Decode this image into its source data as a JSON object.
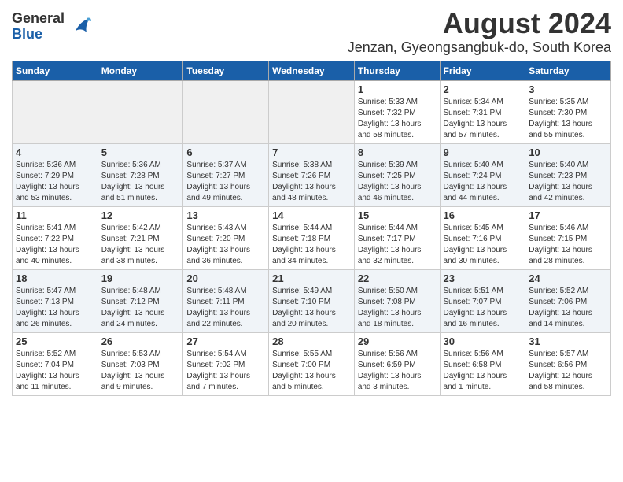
{
  "header": {
    "logo_general": "General",
    "logo_blue": "Blue",
    "title": "August 2024",
    "subtitle": "Jenzan, Gyeongsangbuk-do, South Korea"
  },
  "weekdays": [
    "Sunday",
    "Monday",
    "Tuesday",
    "Wednesday",
    "Thursday",
    "Friday",
    "Saturday"
  ],
  "weeks": [
    [
      {
        "day": "",
        "detail": ""
      },
      {
        "day": "",
        "detail": ""
      },
      {
        "day": "",
        "detail": ""
      },
      {
        "day": "",
        "detail": ""
      },
      {
        "day": "1",
        "detail": "Sunrise: 5:33 AM\nSunset: 7:32 PM\nDaylight: 13 hours\nand 58 minutes."
      },
      {
        "day": "2",
        "detail": "Sunrise: 5:34 AM\nSunset: 7:31 PM\nDaylight: 13 hours\nand 57 minutes."
      },
      {
        "day": "3",
        "detail": "Sunrise: 5:35 AM\nSunset: 7:30 PM\nDaylight: 13 hours\nand 55 minutes."
      }
    ],
    [
      {
        "day": "4",
        "detail": "Sunrise: 5:36 AM\nSunset: 7:29 PM\nDaylight: 13 hours\nand 53 minutes."
      },
      {
        "day": "5",
        "detail": "Sunrise: 5:36 AM\nSunset: 7:28 PM\nDaylight: 13 hours\nand 51 minutes."
      },
      {
        "day": "6",
        "detail": "Sunrise: 5:37 AM\nSunset: 7:27 PM\nDaylight: 13 hours\nand 49 minutes."
      },
      {
        "day": "7",
        "detail": "Sunrise: 5:38 AM\nSunset: 7:26 PM\nDaylight: 13 hours\nand 48 minutes."
      },
      {
        "day": "8",
        "detail": "Sunrise: 5:39 AM\nSunset: 7:25 PM\nDaylight: 13 hours\nand 46 minutes."
      },
      {
        "day": "9",
        "detail": "Sunrise: 5:40 AM\nSunset: 7:24 PM\nDaylight: 13 hours\nand 44 minutes."
      },
      {
        "day": "10",
        "detail": "Sunrise: 5:40 AM\nSunset: 7:23 PM\nDaylight: 13 hours\nand 42 minutes."
      }
    ],
    [
      {
        "day": "11",
        "detail": "Sunrise: 5:41 AM\nSunset: 7:22 PM\nDaylight: 13 hours\nand 40 minutes."
      },
      {
        "day": "12",
        "detail": "Sunrise: 5:42 AM\nSunset: 7:21 PM\nDaylight: 13 hours\nand 38 minutes."
      },
      {
        "day": "13",
        "detail": "Sunrise: 5:43 AM\nSunset: 7:20 PM\nDaylight: 13 hours\nand 36 minutes."
      },
      {
        "day": "14",
        "detail": "Sunrise: 5:44 AM\nSunset: 7:18 PM\nDaylight: 13 hours\nand 34 minutes."
      },
      {
        "day": "15",
        "detail": "Sunrise: 5:44 AM\nSunset: 7:17 PM\nDaylight: 13 hours\nand 32 minutes."
      },
      {
        "day": "16",
        "detail": "Sunrise: 5:45 AM\nSunset: 7:16 PM\nDaylight: 13 hours\nand 30 minutes."
      },
      {
        "day": "17",
        "detail": "Sunrise: 5:46 AM\nSunset: 7:15 PM\nDaylight: 13 hours\nand 28 minutes."
      }
    ],
    [
      {
        "day": "18",
        "detail": "Sunrise: 5:47 AM\nSunset: 7:13 PM\nDaylight: 13 hours\nand 26 minutes."
      },
      {
        "day": "19",
        "detail": "Sunrise: 5:48 AM\nSunset: 7:12 PM\nDaylight: 13 hours\nand 24 minutes."
      },
      {
        "day": "20",
        "detail": "Sunrise: 5:48 AM\nSunset: 7:11 PM\nDaylight: 13 hours\nand 22 minutes."
      },
      {
        "day": "21",
        "detail": "Sunrise: 5:49 AM\nSunset: 7:10 PM\nDaylight: 13 hours\nand 20 minutes."
      },
      {
        "day": "22",
        "detail": "Sunrise: 5:50 AM\nSunset: 7:08 PM\nDaylight: 13 hours\nand 18 minutes."
      },
      {
        "day": "23",
        "detail": "Sunrise: 5:51 AM\nSunset: 7:07 PM\nDaylight: 13 hours\nand 16 minutes."
      },
      {
        "day": "24",
        "detail": "Sunrise: 5:52 AM\nSunset: 7:06 PM\nDaylight: 13 hours\nand 14 minutes."
      }
    ],
    [
      {
        "day": "25",
        "detail": "Sunrise: 5:52 AM\nSunset: 7:04 PM\nDaylight: 13 hours\nand 11 minutes."
      },
      {
        "day": "26",
        "detail": "Sunrise: 5:53 AM\nSunset: 7:03 PM\nDaylight: 13 hours\nand 9 minutes."
      },
      {
        "day": "27",
        "detail": "Sunrise: 5:54 AM\nSunset: 7:02 PM\nDaylight: 13 hours\nand 7 minutes."
      },
      {
        "day": "28",
        "detail": "Sunrise: 5:55 AM\nSunset: 7:00 PM\nDaylight: 13 hours\nand 5 minutes."
      },
      {
        "day": "29",
        "detail": "Sunrise: 5:56 AM\nSunset: 6:59 PM\nDaylight: 13 hours\nand 3 minutes."
      },
      {
        "day": "30",
        "detail": "Sunrise: 5:56 AM\nSunset: 6:58 PM\nDaylight: 13 hours\nand 1 minute."
      },
      {
        "day": "31",
        "detail": "Sunrise: 5:57 AM\nSunset: 6:56 PM\nDaylight: 12 hours\nand 58 minutes."
      }
    ]
  ]
}
